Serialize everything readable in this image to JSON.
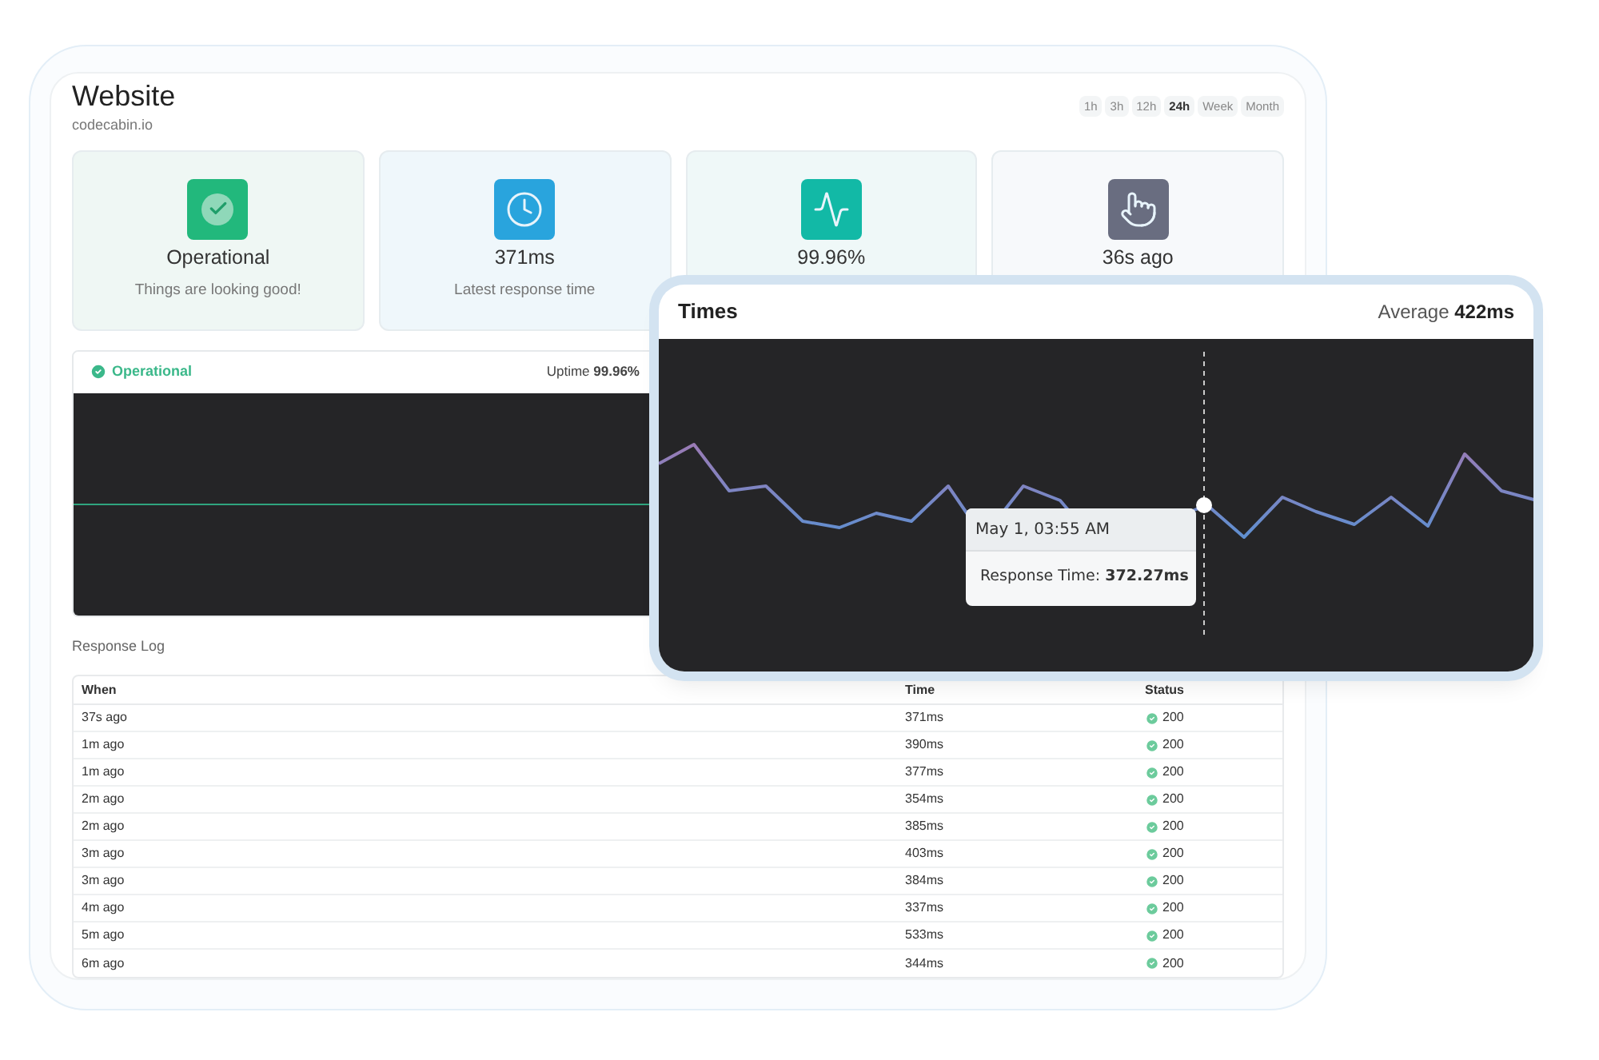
{
  "site": {
    "title": "Website",
    "url": "codecabin.io"
  },
  "ranges": [
    {
      "label": "1h",
      "selected": false
    },
    {
      "label": "3h",
      "selected": false
    },
    {
      "label": "12h",
      "selected": false
    },
    {
      "label": "24h",
      "selected": true
    },
    {
      "label": "Week",
      "selected": false
    },
    {
      "label": "Month",
      "selected": false
    }
  ],
  "stats": [
    {
      "kind": "status",
      "value": "Operational",
      "caption": "Things are looking good!"
    },
    {
      "kind": "response",
      "value": "371ms",
      "caption": "Latest response time"
    },
    {
      "kind": "uptime",
      "value": "99.96%"
    },
    {
      "kind": "checked",
      "value": "36s ago"
    }
  ],
  "uptime_panel": {
    "status": "Operational",
    "uptime_label": "Uptime",
    "uptime_value": "99.96%"
  },
  "response_log": {
    "title": "Response Log",
    "columns": [
      "When",
      "Time",
      "Status"
    ],
    "rows": [
      {
        "when": "37s ago",
        "time": "371ms",
        "status": "200"
      },
      {
        "when": "1m ago",
        "time": "390ms",
        "status": "200"
      },
      {
        "when": "1m ago",
        "time": "377ms",
        "status": "200"
      },
      {
        "when": "2m ago",
        "time": "354ms",
        "status": "200"
      },
      {
        "when": "2m ago",
        "time": "385ms",
        "status": "200"
      },
      {
        "when": "3m ago",
        "time": "403ms",
        "status": "200"
      },
      {
        "when": "3m ago",
        "time": "384ms",
        "status": "200"
      },
      {
        "when": "4m ago",
        "time": "337ms",
        "status": "200"
      },
      {
        "when": "5m ago",
        "time": "533ms",
        "status": "200"
      },
      {
        "when": "6m ago",
        "time": "344ms",
        "status": "200"
      }
    ]
  },
  "times_panel": {
    "title": "Times",
    "average_label": "Average",
    "average_value": "422ms",
    "tooltip": {
      "date": "May 1, 03:55 AM",
      "label": "Response Time:",
      "value": "372.27ms"
    }
  }
}
